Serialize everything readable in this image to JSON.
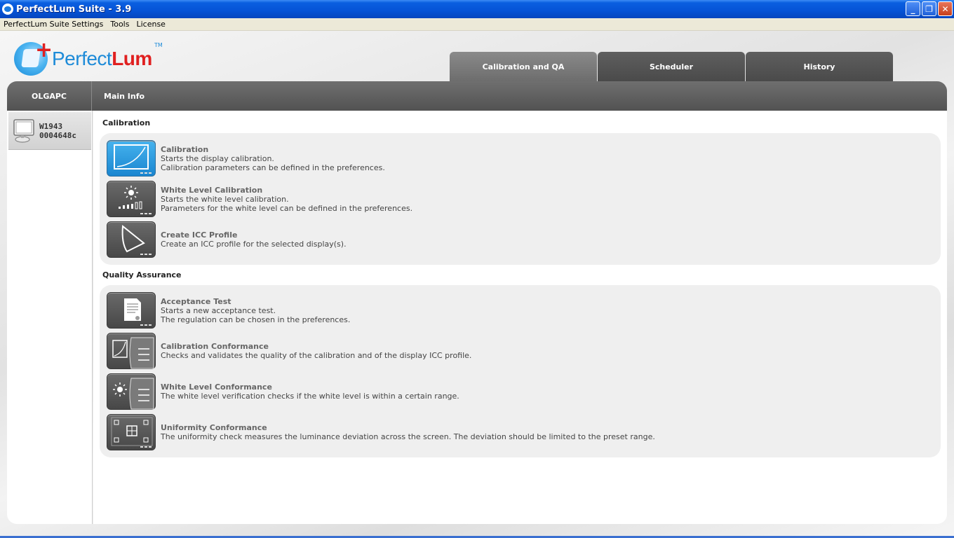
{
  "window": {
    "title": "PerfectLum Suite - 3.9",
    "buttons": [
      "_",
      "❐",
      "✕"
    ]
  },
  "menu": [
    "PerfectLum Suite Settings",
    "Tools",
    "License"
  ],
  "logo": {
    "prefix": "Perfect",
    "suffix": "Lum",
    "tm": "TM"
  },
  "tabs": [
    "Calibration and QA",
    "Scheduler",
    "History"
  ],
  "header": {
    "host": "OLGAPC",
    "section": "Main Info"
  },
  "display": {
    "model": "W1943",
    "serial": "0004648c"
  },
  "groups": {
    "calibration": {
      "title": "Calibration",
      "items": [
        {
          "name": "Calibration",
          "desc1": "Starts the display calibration.",
          "desc2": "Calibration parameters can be defined in the preferences."
        },
        {
          "name": "White Level Calibration",
          "desc1": "Starts the white level calibration.",
          "desc2": "Parameters for the white level can be defined in the preferences."
        },
        {
          "name": "Create ICC Profile",
          "desc1": "Create an ICC profile for the selected display(s).",
          "desc2": ""
        }
      ]
    },
    "qa": {
      "title": "Quality Assurance",
      "items": [
        {
          "name": "Acceptance Test",
          "desc1": "Starts a new acceptance test.",
          "desc2": "The regulation can be chosen in the preferences."
        },
        {
          "name": "Calibration Conformance",
          "desc1": "Checks and validates the quality of the calibration and of the display ICC profile.",
          "desc2": ""
        },
        {
          "name": "White Level Conformance",
          "desc1": "The white level verification checks if the white level is within a certain range.",
          "desc2": ""
        },
        {
          "name": "Uniformity Conformance",
          "desc1": "The uniformity check measures the luminance deviation across the screen. The deviation should be limited to the preset range.",
          "desc2": ""
        }
      ]
    }
  }
}
